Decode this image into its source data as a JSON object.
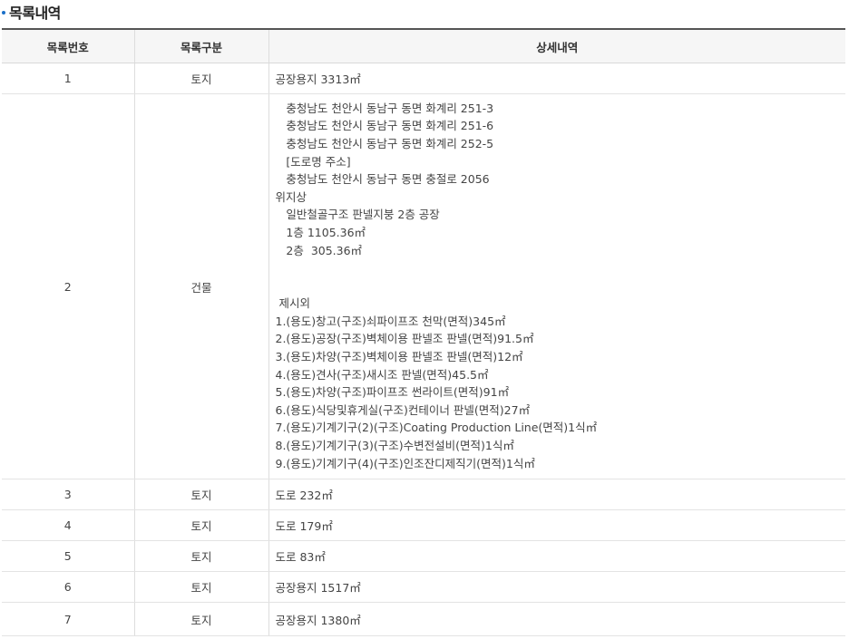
{
  "section": {
    "title": "목록내역"
  },
  "table": {
    "headers": {
      "number": "목록번호",
      "category": "목록구분",
      "detail": "상세내역"
    },
    "rows": [
      {
        "number": "1",
        "category": "토지",
        "detail": "공장용지 3313㎡"
      },
      {
        "number": "2",
        "category": "건물",
        "detail_lines": [
          "   충청남도 천안시 동남구 동면 화계리 251-3",
          "   충청남도 천안시 동남구 동면 화계리 251-6",
          "   충청남도 천안시 동남구 동면 화계리 252-5",
          "   [도로명 주소]",
          "   충청남도 천안시 동남구 동면 충절로 2056",
          "위지상",
          "   일반철골구조 판넬지붕 2층 공장",
          "   1층 1105.36㎡",
          "   2층  305.36㎡",
          "",
          "",
          " 제시외",
          "1.(용도)창고(구조)쇠파이프조 천막(면적)345㎡",
          "2.(용도)공장(구조)벽체이용 판넬조 판넬(면적)91.5㎡",
          "3.(용도)차양(구조)벽체이용 판넬조 판넬(면적)12㎡",
          "4.(용도)견사(구조)새시조 판넬(면적)45.5㎡",
          "5.(용도)차양(구조)파이프조 썬라이트(면적)91㎡",
          "6.(용도)식당및휴게실(구조)컨테이너 판넬(면적)27㎡",
          "7.(용도)기계기구(2)(구조)Coating Production Line(면적)1식㎡",
          "8.(용도)기계기구(3)(구조)수변전설비(면적)1식㎡",
          "9.(용도)기계기구(4)(구조)인조잔디제직기(면적)1식㎡"
        ]
      },
      {
        "number": "3",
        "category": "토지",
        "detail": "도로 232㎡"
      },
      {
        "number": "4",
        "category": "토지",
        "detail": "도로 179㎡"
      },
      {
        "number": "5",
        "category": "토지",
        "detail": "도로 83㎡"
      },
      {
        "number": "6",
        "category": "토지",
        "detail": "공장용지 1517㎡"
      },
      {
        "number": "7",
        "category": "토지",
        "detail": "공장용지 1380㎡"
      }
    ]
  }
}
